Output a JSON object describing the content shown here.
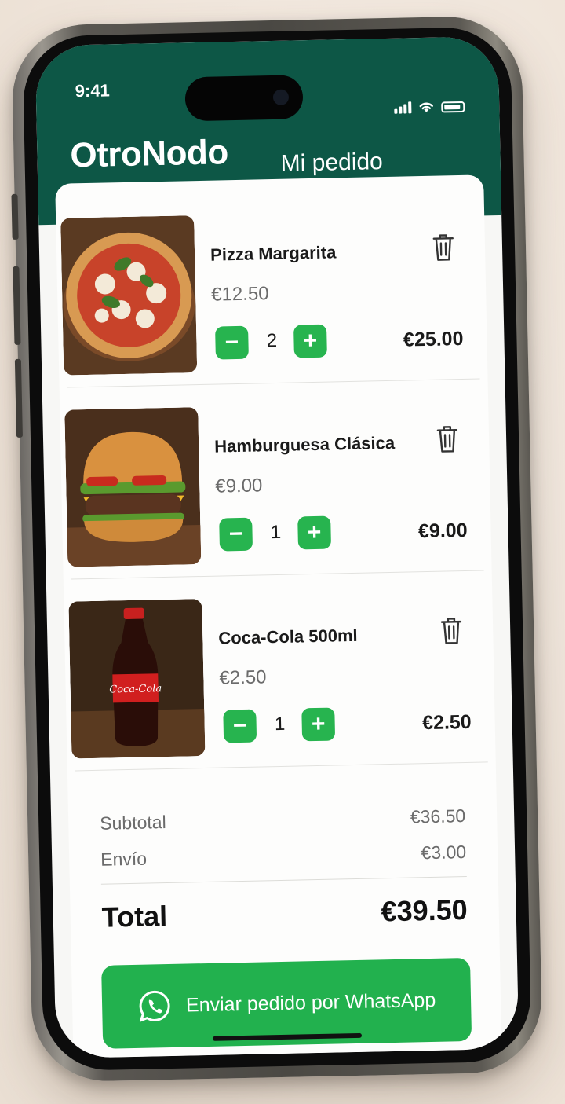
{
  "status_bar": {
    "time": "9:41"
  },
  "header": {
    "logo": "OtroNodo",
    "title": "Mi pedido"
  },
  "items": [
    {
      "name": "Pizza Margarita",
      "unit_price": "€12.50",
      "quantity": "2",
      "line_total": "€25.00",
      "image": "pizza-image",
      "minus": "−",
      "plus": "+"
    },
    {
      "name": "Hamburguesa Clásica",
      "unit_price": "€9.00",
      "quantity": "1",
      "line_total": "€9.00",
      "image": "burger-image",
      "minus": "−",
      "plus": "+"
    },
    {
      "name": "Coca-Cola 500ml",
      "unit_price": "€2.50",
      "quantity": "1",
      "line_total": "€2.50",
      "image": "cola-image",
      "minus": "−",
      "plus": "+"
    }
  ],
  "summary": {
    "subtotal_label": "Subtotal",
    "subtotal_value": "€36.50",
    "shipping_label": "Envío",
    "shipping_value": "€3.00",
    "total_label": "Total",
    "total_value": "€39.50"
  },
  "cta": {
    "label": "Enviar pedido por WhatsApp",
    "icon": "whatsapp-icon"
  },
  "colors": {
    "header": "#0d5746",
    "accent": "#27b44f",
    "cta": "#22b14e"
  }
}
